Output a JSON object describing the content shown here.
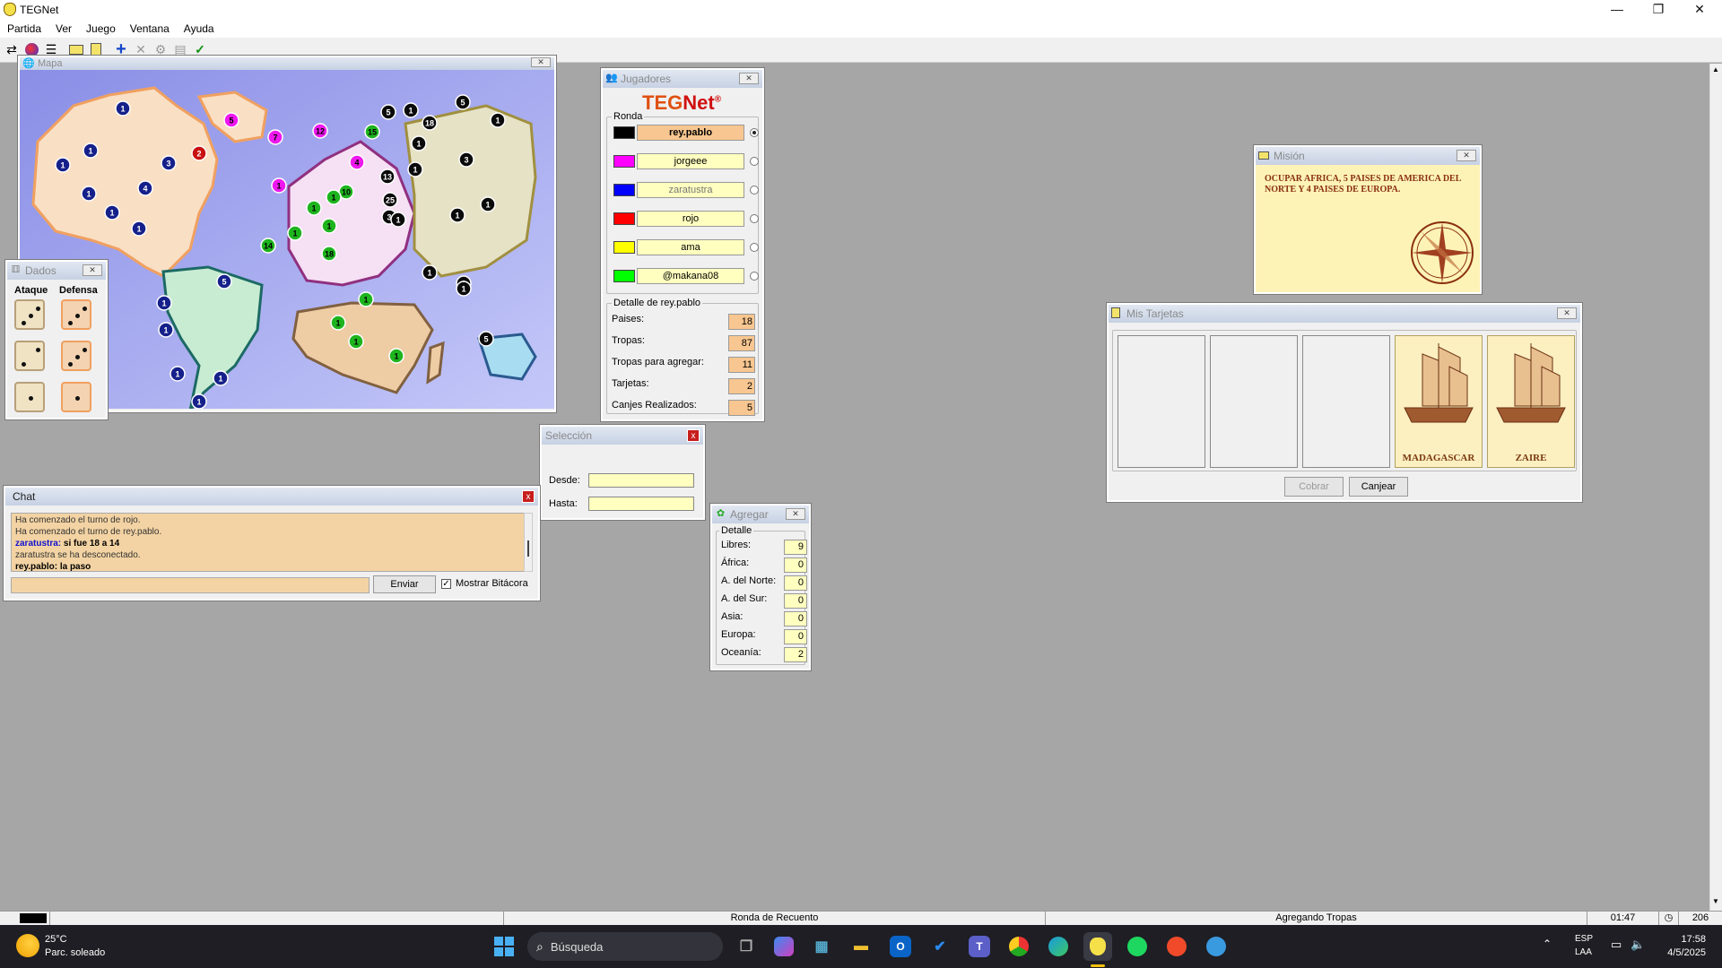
{
  "app": {
    "title": "TEGNet"
  },
  "menu": [
    "Partida",
    "Ver",
    "Juego",
    "Ventana",
    "Ayuda"
  ],
  "toolbar": {
    "icons": [
      "connect-icon",
      "globe-icon",
      "list-icon",
      "card-icon",
      "mission-icon",
      "add-icon",
      "close-icon",
      "settings-icon",
      "copy-icon",
      "check-icon"
    ]
  },
  "map": {
    "title": "Mapa",
    "countries": [
      {
        "v": "1",
        "c": "navy"
      },
      {
        "v": "1",
        "c": "navy"
      },
      {
        "v": "1",
        "c": "navy"
      },
      {
        "v": "3",
        "c": "navy"
      },
      {
        "v": "4",
        "c": "navy"
      },
      {
        "v": "1",
        "c": "navy"
      },
      {
        "v": "1",
        "c": "navy"
      },
      {
        "v": "1",
        "c": "navy"
      },
      {
        "v": "2",
        "c": "red"
      },
      {
        "v": "5",
        "c": "magenta"
      },
      {
        "v": "7",
        "c": "magenta"
      },
      {
        "v": "12",
        "c": "magenta"
      },
      {
        "v": "4",
        "c": "magenta"
      },
      {
        "v": "1",
        "c": "magenta"
      },
      {
        "v": "5",
        "c": "black"
      },
      {
        "v": "1",
        "c": "black"
      },
      {
        "v": "18",
        "c": "black"
      },
      {
        "v": "5",
        "c": "black"
      },
      {
        "v": "1",
        "c": "black"
      },
      {
        "v": "1",
        "c": "black"
      },
      {
        "v": "3",
        "c": "black"
      },
      {
        "v": "1",
        "c": "black"
      },
      {
        "v": "13",
        "c": "black"
      },
      {
        "v": "25",
        "c": "black"
      },
      {
        "v": "3",
        "c": "black"
      },
      {
        "v": "1",
        "c": "black"
      },
      {
        "v": "1",
        "c": "black"
      },
      {
        "v": "1",
        "c": "black"
      },
      {
        "v": "1",
        "c": "black"
      },
      {
        "v": "1",
        "c": "black"
      },
      {
        "v": "1",
        "c": "black"
      },
      {
        "v": "5",
        "c": "black"
      },
      {
        "v": "15",
        "c": "green"
      },
      {
        "v": "10",
        "c": "green"
      },
      {
        "v": "1",
        "c": "green"
      },
      {
        "v": "1",
        "c": "green"
      },
      {
        "v": "1",
        "c": "green"
      },
      {
        "v": "1",
        "c": "green"
      },
      {
        "v": "14",
        "c": "green"
      },
      {
        "v": "18",
        "c": "green"
      },
      {
        "v": "1",
        "c": "green"
      },
      {
        "v": "1",
        "c": "green"
      },
      {
        "v": "1",
        "c": "green"
      },
      {
        "v": "1",
        "c": "green"
      },
      {
        "v": "1",
        "c": "navy"
      },
      {
        "v": "5",
        "c": "navy"
      },
      {
        "v": "1",
        "c": "navy"
      },
      {
        "v": "1",
        "c": "navy"
      },
      {
        "v": "1",
        "c": "navy"
      },
      {
        "v": "1",
        "c": "navy"
      }
    ]
  },
  "dados": {
    "title": "Dados",
    "attack_label": "Ataque",
    "defense_label": "Defensa",
    "attack": [
      3,
      2,
      1
    ],
    "defense": [
      3,
      3,
      1
    ]
  },
  "jugadores": {
    "title": "Jugadores",
    "logo_a": "TEG",
    "logo_b": "Net",
    "logo_reg": "®",
    "ronda_label": "Ronda",
    "players": [
      {
        "name": "rey.pablo",
        "color": "#000000",
        "active": true
      },
      {
        "name": "jorgeee",
        "color": "#ff00ff",
        "active": false
      },
      {
        "name": "zaratustra",
        "color": "#0000ff",
        "active": false
      },
      {
        "name": "rojo",
        "color": "#ff0000",
        "active": false
      },
      {
        "name": "ama",
        "color": "#ffff00",
        "active": false
      },
      {
        "name": "@makana08",
        "color": "#00ff00",
        "active": false
      }
    ],
    "detalle_label": "Detalle de rey.pablo",
    "details": [
      {
        "label": "Paises:",
        "value": "18"
      },
      {
        "label": "Tropas:",
        "value": "87"
      },
      {
        "label": "Tropas para agregar:",
        "value": "11"
      },
      {
        "label": "Tarjetas:",
        "value": "2"
      },
      {
        "label": "Canjes Realizados:",
        "value": "5"
      }
    ]
  },
  "mision": {
    "title": "Misión",
    "text": "OCUPAR AFRICA, 5 PAISES DE AMERICA DEL NORTE Y 4 PAISES DE EUROPA."
  },
  "tarjetas": {
    "title": "Mis Tarjetas",
    "cards": [
      "",
      "",
      "",
      "MADAGASCAR",
      "ZAIRE"
    ],
    "cobrar": "Cobrar",
    "canjear": "Canjear"
  },
  "seleccion": {
    "title": "Selección",
    "desde_label": "Desde:",
    "hasta_label": "Hasta:",
    "desde": "",
    "hasta": ""
  },
  "agregar": {
    "title": "Agregar",
    "detalle_label": "Detalle",
    "rows": [
      {
        "label": "Libres:",
        "value": "9"
      },
      {
        "label": "África:",
        "value": "0"
      },
      {
        "label": "A. del Norte:",
        "value": "0"
      },
      {
        "label": "A. del Sur:",
        "value": "0"
      },
      {
        "label": "Asia:",
        "value": "0"
      },
      {
        "label": "Europa:",
        "value": "0"
      },
      {
        "label": "Oceanía:",
        "value": "2"
      }
    ]
  },
  "chat": {
    "title": "Chat",
    "lines": [
      {
        "text": "Ha comenzado el turno de rojo.",
        "style": "sys"
      },
      {
        "text": "Ha comenzado el turno de rey.pablo.",
        "style": "sys"
      },
      {
        "who": "zaratustra:",
        "text": " si fue 18 a 14",
        "style": "msgblue"
      },
      {
        "text": "zaratustra se ha desconectado.",
        "style": "sys"
      },
      {
        "who": "rey.pablo:",
        "text": " la paso",
        "style": "msgblack"
      }
    ],
    "input": "",
    "send": "Enviar",
    "show_log": "Mostrar Bitácora"
  },
  "status": {
    "round": "Ronda de Recuento",
    "phase": "Agregando Tropas",
    "time": "01:47",
    "count": "206"
  },
  "taskbar": {
    "temp": "25°C",
    "weather": "Parc. soleado",
    "search": "Búsqueda",
    "lang1": "ESP",
    "lang2": "LAA",
    "time": "17:58",
    "date": "4/5/2025"
  }
}
